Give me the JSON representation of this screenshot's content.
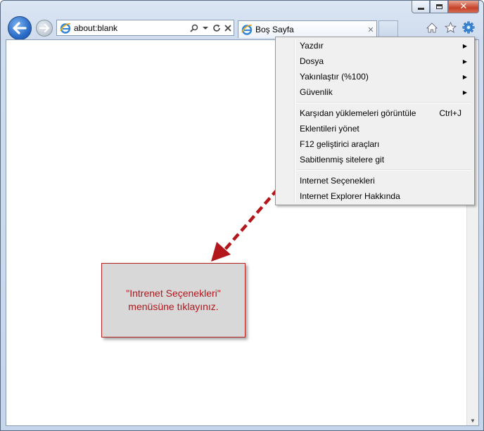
{
  "window": {
    "minimize": "minimize",
    "maximize": "maximize",
    "close": "✕"
  },
  "address_bar": {
    "url": "about:blank"
  },
  "tab": {
    "title": "Boş Sayfa",
    "close": "✕"
  },
  "tools": {
    "home": "home-icon",
    "favorites": "star-icon",
    "settings": "gear-icon"
  },
  "menu": {
    "items": [
      {
        "label": "Yazdır",
        "submenu": true
      },
      {
        "label": "Dosya",
        "submenu": true
      },
      {
        "label": "Yakınlaştır (%100)",
        "submenu": true
      },
      {
        "label": "Güvenlik",
        "submenu": true
      },
      {
        "label": "Karşıdan yüklemeleri görüntüle",
        "shortcut": "Ctrl+J"
      },
      {
        "label": "Eklentileri yönet"
      },
      {
        "label": "F12 geliştirici araçları"
      },
      {
        "label": "Sabitlenmiş sitelere git"
      },
      {
        "label": "Internet Seçenekleri"
      },
      {
        "label": "Internet Explorer Hakkında"
      }
    ]
  },
  "callout": {
    "line1": "\"Intrenet Seçenekleri\"",
    "line2": "menüsüne tıklayınız."
  },
  "colors": {
    "accent_red": "#b3161b",
    "menu_bg": "#f0f0f0"
  }
}
